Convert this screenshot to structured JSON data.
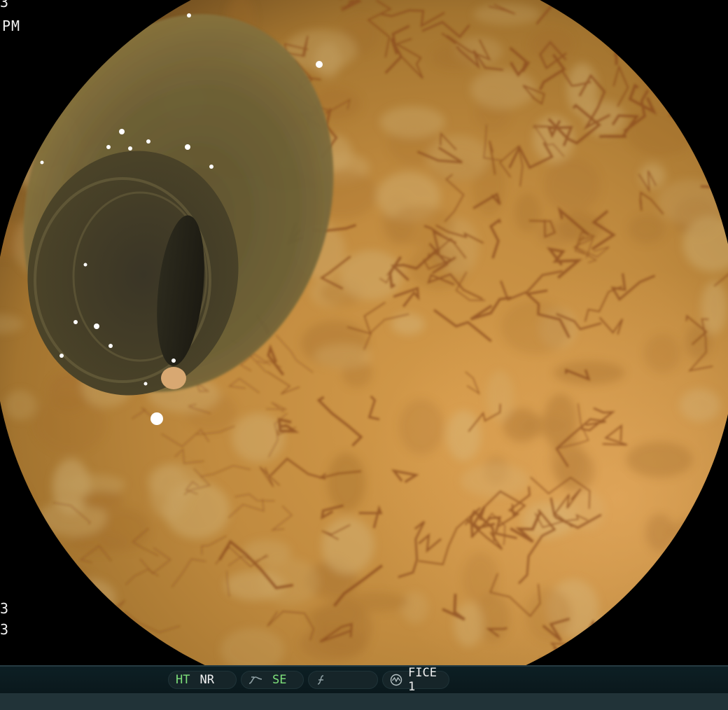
{
  "overlay": {
    "top_line": "3",
    "time_suffix": "PM",
    "bottom_line_1": "3",
    "bottom_line_2": "3"
  },
  "status_bar": {
    "ht_label": "HT",
    "nr_label": "NR",
    "se_label": "SE",
    "fice_label": "FICE 1",
    "accent_color": "#7ee07a"
  },
  "view": {
    "mucosa_base": "#c08a3c",
    "lumen_color": "#2a2418"
  }
}
